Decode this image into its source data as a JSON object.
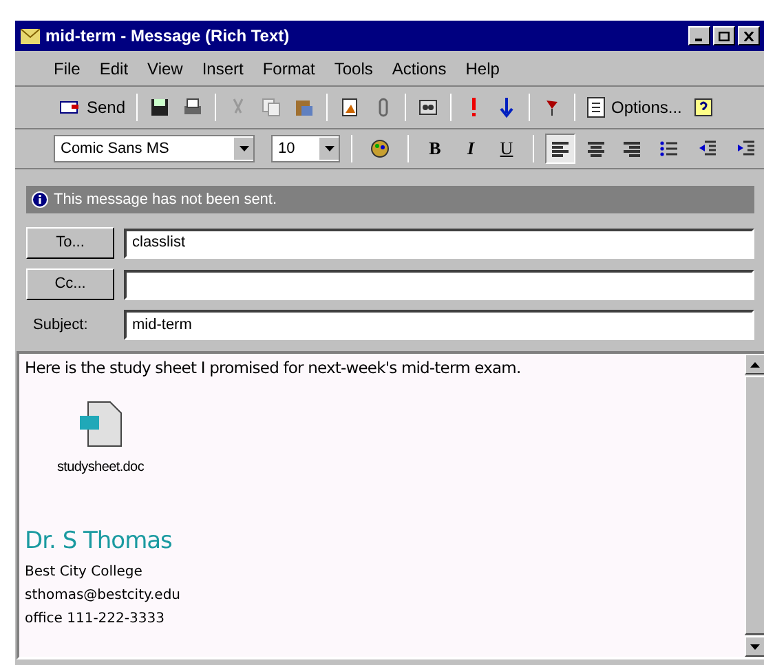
{
  "window": {
    "title": "mid-term - Message (Rich Text)"
  },
  "menu": [
    "File",
    "Edit",
    "View",
    "Insert",
    "Format",
    "Tools",
    "Actions",
    "Help"
  ],
  "toolbar": {
    "send": "Send",
    "options": "Options..."
  },
  "format_bar": {
    "font": "Comic Sans MS",
    "size": "10",
    "bold": "B",
    "italic": "I",
    "underline": "U",
    "align": [
      {
        "kind": "left",
        "selected": true
      },
      {
        "kind": "center",
        "selected": false
      },
      {
        "kind": "right",
        "selected": false
      }
    ]
  },
  "info_bar": "This message has not been sent.",
  "fields": [
    {
      "kind": "button",
      "label": "To...",
      "value": "classlist"
    },
    {
      "kind": "button",
      "label": "Cc..."
    },
    {
      "kind": "label",
      "label": "Subject:",
      "value": "mid-term"
    }
  ],
  "body": {
    "text": "Here is the study sheet I promised for next-week's mid-term exam.",
    "attachment": "studysheet.doc",
    "signature": {
      "name": "Dr. S Thomas",
      "lines": [
        "Best City College",
        "sthomas@bestcity.edu",
        "office 111-222-3333"
      ]
    }
  }
}
